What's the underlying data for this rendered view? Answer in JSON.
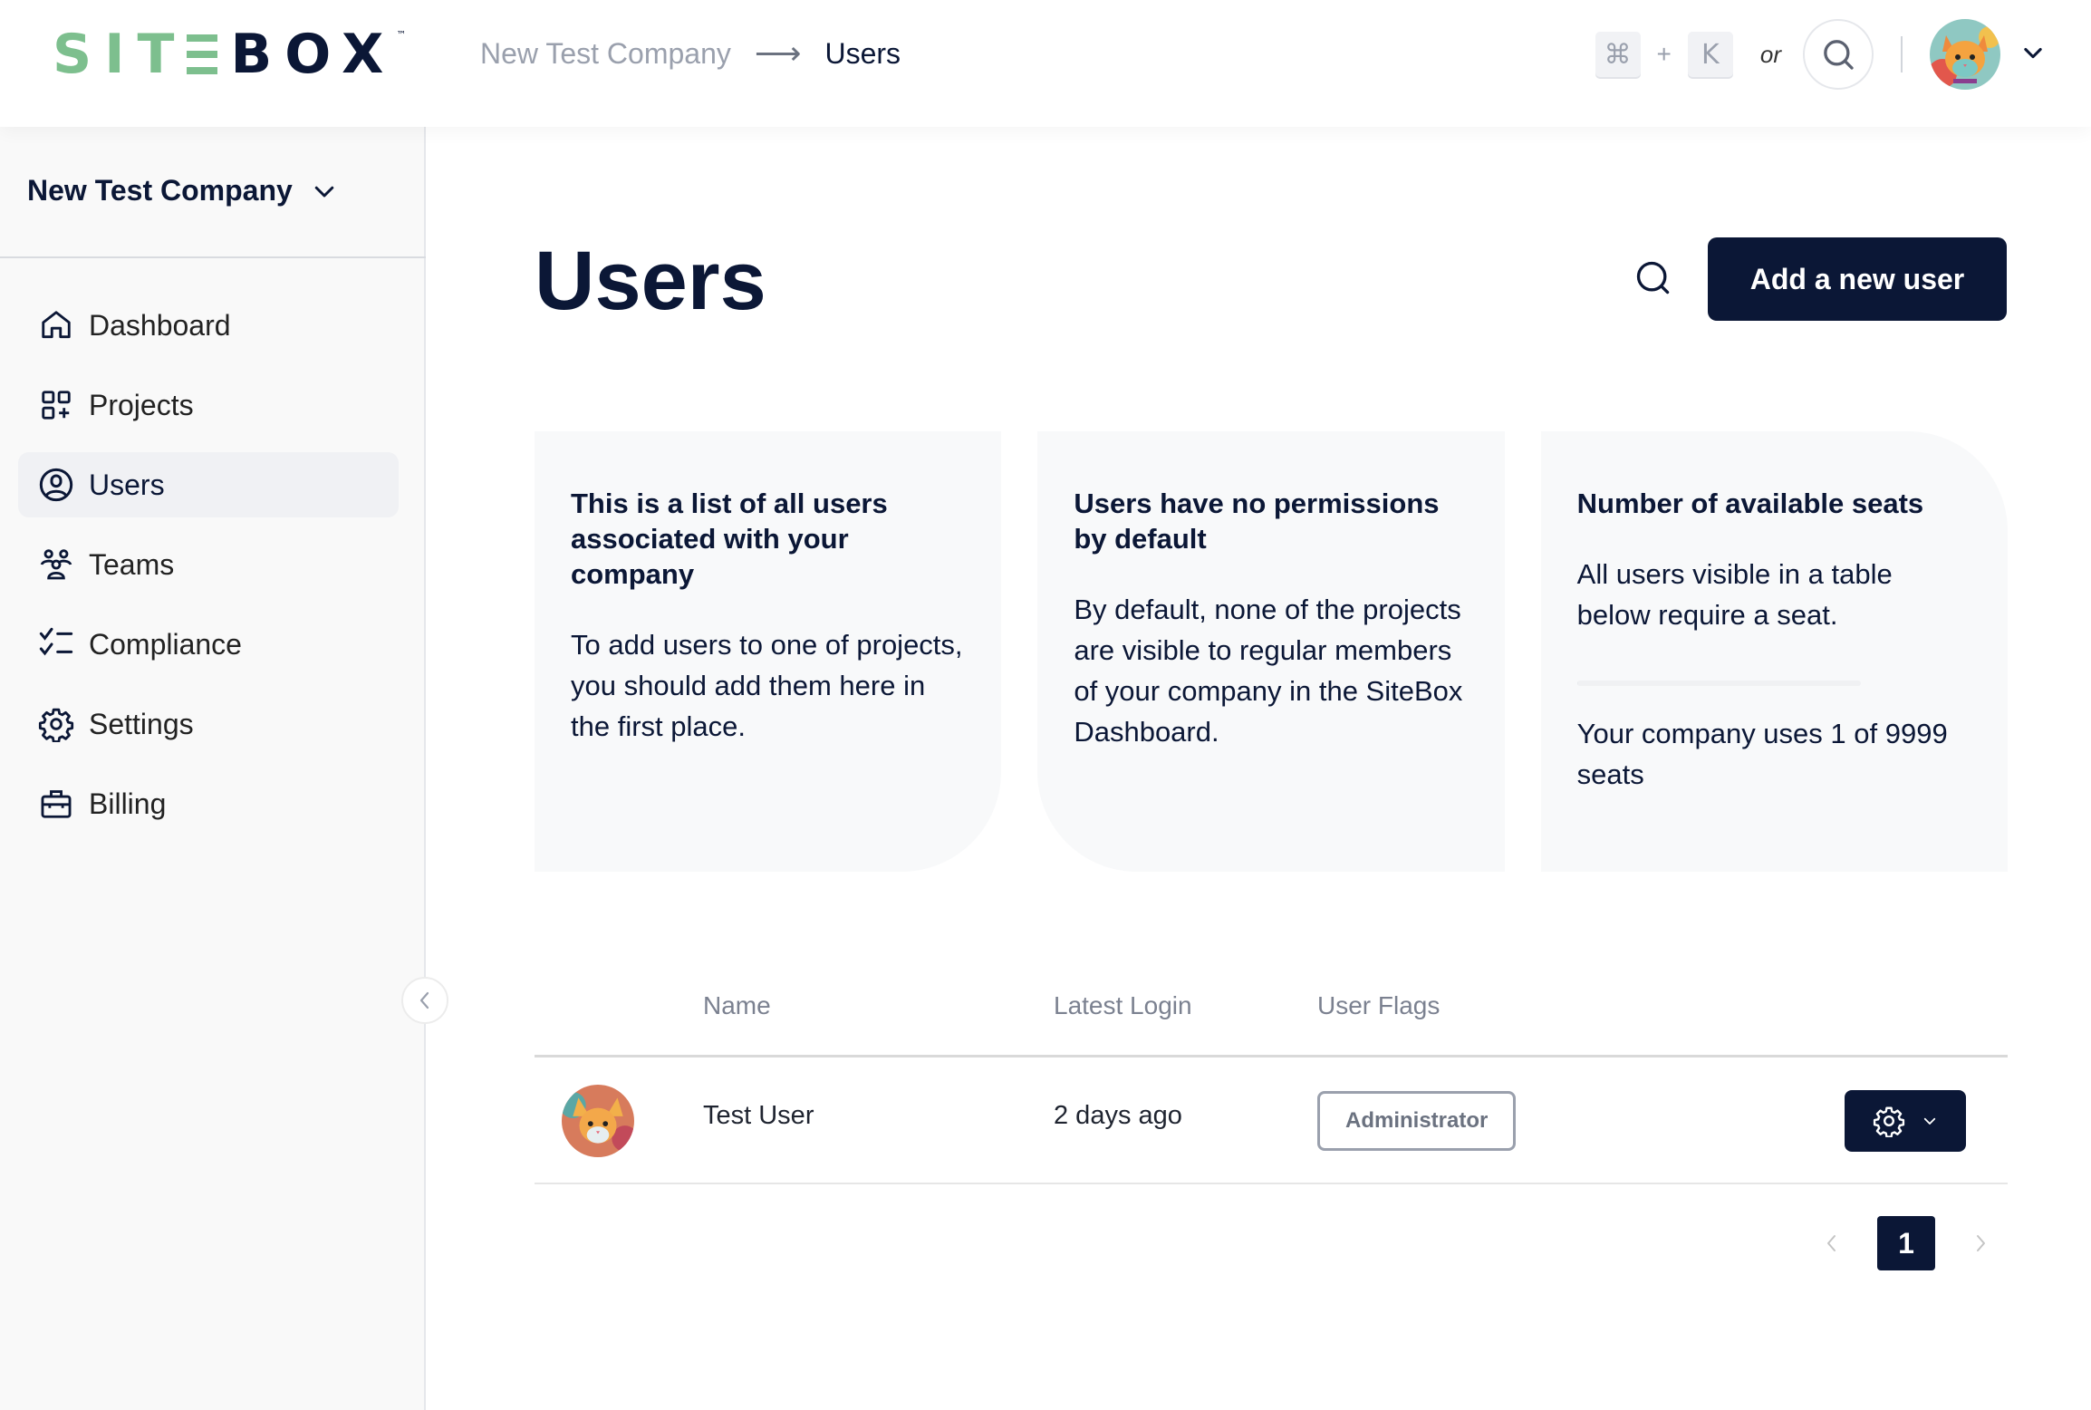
{
  "brand": {
    "logo_green": "SIT",
    "logo_navy": "BOX",
    "trademark": "™",
    "colors": {
      "green": "#7dbf8e",
      "navy": "#0b1736"
    }
  },
  "header": {
    "breadcrumb": {
      "parent": "New Test Company",
      "arrow": "⟶",
      "current": "Users"
    },
    "shortcut": {
      "key1": "⌘",
      "plus": "+",
      "key2": "K",
      "or": "or"
    },
    "search_icon": "search-icon",
    "user_menu_icon": "chevron-down-icon"
  },
  "sidebar": {
    "company_name": "New Test Company",
    "items": [
      {
        "label": "Dashboard",
        "icon": "home-icon",
        "active": false
      },
      {
        "label": "Projects",
        "icon": "grid-plus-icon",
        "active": false
      },
      {
        "label": "Users",
        "icon": "user-circle-icon",
        "active": true
      },
      {
        "label": "Teams",
        "icon": "team-icon",
        "active": false
      },
      {
        "label": "Compliance",
        "icon": "checklist-icon",
        "active": false
      },
      {
        "label": "Settings",
        "icon": "gear-icon",
        "active": false
      },
      {
        "label": "Billing",
        "icon": "briefcase-icon",
        "active": false
      }
    ]
  },
  "main": {
    "title": "Users",
    "add_user_label": "Add a new user",
    "cards": [
      {
        "title": "This is a list of all users associated with your company",
        "body": "To add users to one of projects, you should add them here in the first place."
      },
      {
        "title": "Users have no permissions by default",
        "body": "By default, none of the projects are visible to regular members of your company in the SiteBox Dashboard."
      },
      {
        "title": "Number of available seats",
        "body": "All users visible in a table below require a seat.",
        "seats_used": 1,
        "seats_total": 9999,
        "usage_text": "Your company uses 1 of 9999 seats"
      }
    ],
    "table": {
      "columns": [
        "Name",
        "Latest Login",
        "User Flags"
      ],
      "rows": [
        {
          "name": "Test User",
          "latest_login": "2 days ago",
          "flags": [
            "Administrator"
          ]
        }
      ]
    },
    "pagination": {
      "current_page": "1",
      "prev_icon": "chevron-left-icon",
      "next_icon": "chevron-right-icon"
    }
  }
}
